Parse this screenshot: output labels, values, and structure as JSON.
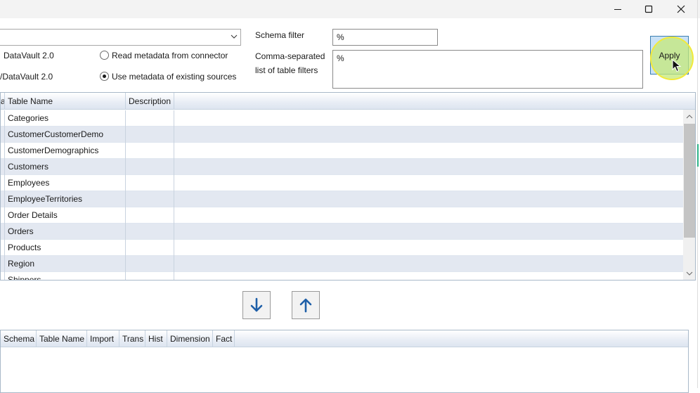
{
  "window": {
    "minimize_icon": "minimize-icon",
    "maximize_icon": "maximize-icon",
    "close_icon": "close-icon"
  },
  "combo": {
    "value": ""
  },
  "left_labels": {
    "line1": "DataVault 2.0",
    "line2": "/DataVault 2.0"
  },
  "radios": {
    "read_connector": {
      "label": "Read metadata from connector",
      "checked": false
    },
    "use_existing": {
      "label": "Use metadata of existing sources",
      "checked": true
    }
  },
  "filters": {
    "schema_label": "Schema filter",
    "schema_value": "%",
    "tables_label_line1": "Comma-separated",
    "tables_label_line2": "list of table filters",
    "tables_value": "%"
  },
  "apply_label": "Apply",
  "upper_grid": {
    "columns": [
      "a",
      "Table Name",
      "Description"
    ],
    "rows": [
      "Categories",
      "CustomerCustomerDemo",
      "CustomerDemographics",
      "Customers",
      "Employees",
      "EmployeeTerritories",
      "Order Details",
      "Orders",
      "Products",
      "Region",
      "Shippers"
    ]
  },
  "move_buttons": {
    "down_icon": "arrow-down-icon",
    "up_icon": "arrow-up-icon"
  },
  "lower_grid": {
    "columns": [
      "Schema",
      "Table Name",
      "Import",
      "Trans",
      "Hist",
      "Dimension",
      "Fact"
    ]
  }
}
